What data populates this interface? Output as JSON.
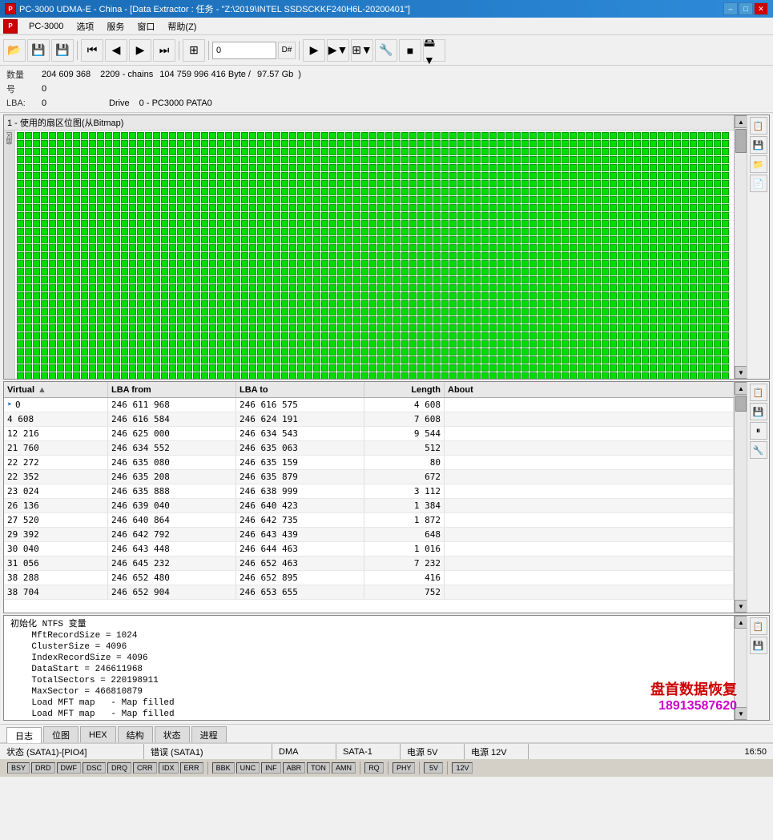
{
  "titlebar": {
    "icon_label": "P",
    "title": "PC-3000 UDMA-E - China - [Data Extractor : 任务 - \"Z:\\2019\\INTEL SSDSCKKF240H6L-20200401\"]",
    "min": "–",
    "max": "□",
    "close": "✕"
  },
  "menubar": {
    "icon_label": "P",
    "app_name": "PC-3000",
    "items": [
      "选项",
      "服务",
      "窗口",
      "帮助(Z)"
    ]
  },
  "toolbar": {
    "buttons": [
      "📁",
      "💾",
      "💾",
      "⏮",
      "◀",
      "▶",
      "⏭",
      "≡",
      "⚙"
    ],
    "input_value": "0",
    "input_right": "D#",
    "extra_btns": [
      "▶",
      "▶▼",
      "⊞▼",
      "🔧",
      "■",
      "🖴▼"
    ]
  },
  "info": {
    "quantity_label": "数量",
    "quantity_value": "204 609 368",
    "chains_count": "2209 - chains",
    "size_bytes": "104 759 996 416 Byte /",
    "size_gb": "97.57 Gb",
    "num_label": "号",
    "num_value": "0",
    "lba_label": "LBA:",
    "lba_value": "0",
    "drive_label": "Drive",
    "drive_value": "0 - PC3000 PATA0"
  },
  "bitmap": {
    "title": "1 - 使用的扇区位图(从Bitmap)",
    "cell_count": 3000
  },
  "table": {
    "columns": [
      "Virtual",
      "LBA from",
      "LBA to",
      "Length",
      "About"
    ],
    "sort_col": "Virtual",
    "rows": [
      {
        "virtual": "0",
        "lba_from": "246 611 968",
        "lba_to": "246 616 575",
        "length": "4 608",
        "about": ""
      },
      {
        "virtual": "4 608",
        "lba_from": "246 616 584",
        "lba_to": "246 624 191",
        "length": "7 608",
        "about": ""
      },
      {
        "virtual": "12 216",
        "lba_from": "246 625 000",
        "lba_to": "246 634 543",
        "length": "9 544",
        "about": ""
      },
      {
        "virtual": "21 760",
        "lba_from": "246 634 552",
        "lba_to": "246 635 063",
        "length": "512",
        "about": ""
      },
      {
        "virtual": "22 272",
        "lba_from": "246 635 080",
        "lba_to": "246 635 159",
        "length": "80",
        "about": ""
      },
      {
        "virtual": "22 352",
        "lba_from": "246 635 208",
        "lba_to": "246 635 879",
        "length": "672",
        "about": ""
      },
      {
        "virtual": "23 024",
        "lba_from": "246 635 888",
        "lba_to": "246 638 999",
        "length": "3 112",
        "about": ""
      },
      {
        "virtual": "26 136",
        "lba_from": "246 639 040",
        "lba_to": "246 640 423",
        "length": "1 384",
        "about": ""
      },
      {
        "virtual": "27 520",
        "lba_from": "246 640 864",
        "lba_to": "246 642 735",
        "length": "1 872",
        "about": ""
      },
      {
        "virtual": "29 392",
        "lba_from": "246 642 792",
        "lba_to": "246 643 439",
        "length": "648",
        "about": ""
      },
      {
        "virtual": "30 040",
        "lba_from": "246 643 448",
        "lba_to": "246 644 463",
        "length": "1 016",
        "about": ""
      },
      {
        "virtual": "31 056",
        "lba_from": "246 645 232",
        "lba_to": "246 652 463",
        "length": "7 232",
        "about": ""
      },
      {
        "virtual": "38 288",
        "lba_from": "246 652 480",
        "lba_to": "246 652 895",
        "length": "416",
        "about": ""
      },
      {
        "virtual": "38 704",
        "lba_from": "246 652 904",
        "lba_to": "246 653 655",
        "length": "752",
        "about": ""
      }
    ]
  },
  "log": {
    "title": "log",
    "lines": [
      "初始化 NTFS 变量",
      "    MftRecordSize = 1024",
      "    ClusterSize = 4096",
      "    IndexRecordSize = 4096",
      "    DataStart = 246611968",
      "    TotalSectors = 220198911",
      "    MaxSector = 466810879",
      "    Load MFT map   - Map filled",
      "    Load MFT map   - Map filled"
    ]
  },
  "watermark": {
    "line1": "盘首数据恢复",
    "line2": "18913587620"
  },
  "tabs": {
    "items": [
      "日志",
      "位图",
      "HEX",
      "结构",
      "状态",
      "进程"
    ],
    "active": "日志"
  },
  "statusbar": {
    "row1": {
      "section1": "状态 (SATA1)-[PIO4]",
      "section2": "错误 (SATA1)",
      "section3": "DMA",
      "section4": "SATA-1",
      "section5": "电源 5V",
      "section6": "电源 12V",
      "time": "16:50"
    },
    "row2": {
      "group1_label": "",
      "indicators1": [
        "BSY",
        "DRD",
        "DWF",
        "DSC",
        "DRQ",
        "CRR",
        "IDX",
        "ERR"
      ],
      "indicators2": [
        "BBK",
        "UNC",
        "INF",
        "ABR",
        "TON",
        "AMN"
      ],
      "indicators3": [
        "RQ"
      ],
      "indicators4": [
        "PHY"
      ],
      "indicators5": [
        "5V"
      ],
      "indicators6": [
        "12V"
      ]
    }
  },
  "right_panel": {
    "top_icons": [
      "📋",
      "💾",
      "📁▼",
      "📄"
    ],
    "mid_icons": [
      "📋",
      "💾",
      "⏸",
      "🔧"
    ]
  }
}
